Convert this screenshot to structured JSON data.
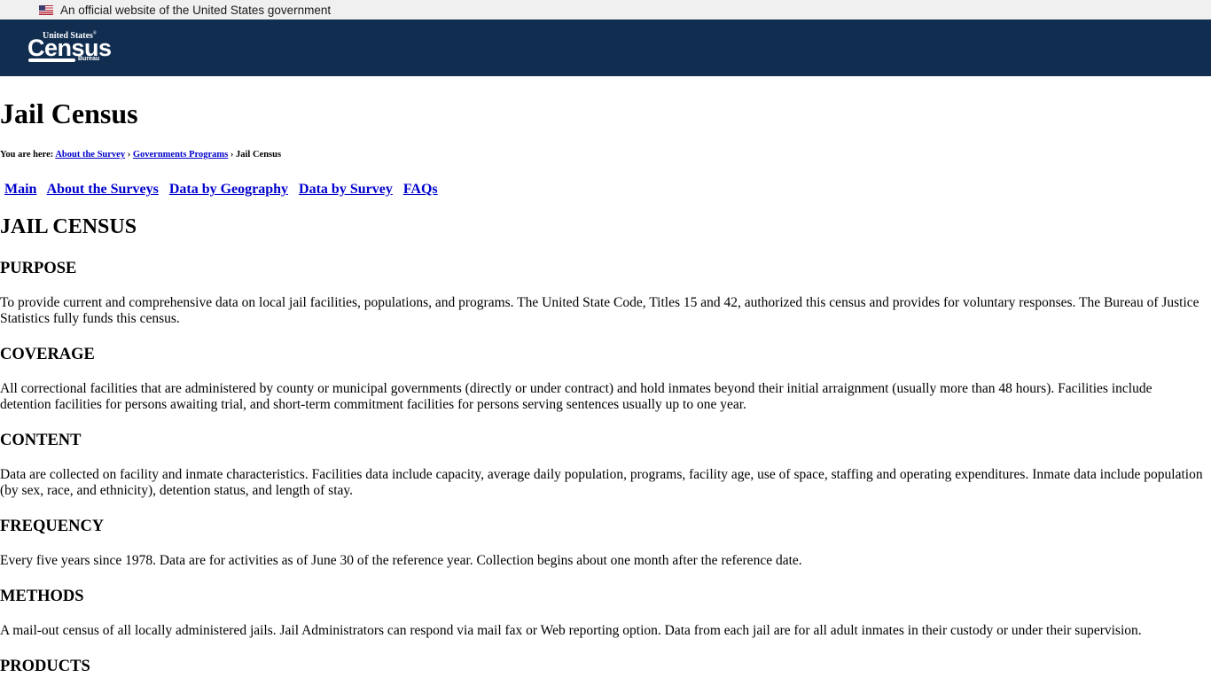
{
  "gov_banner": {
    "flag_icon": "us-flag-icon",
    "text": "An official website of the United States government"
  },
  "header": {
    "logo": {
      "line1": "United States",
      "registered": "®",
      "line2": "Census",
      "line3": "Bureau"
    }
  },
  "page_title": "Jail Census",
  "breadcrumb": {
    "prefix": "You are here:",
    "items": [
      {
        "label": "About the Survey",
        "link": true
      },
      {
        "label": "Governments Programs",
        "link": true
      },
      {
        "label": "Jail Census",
        "link": false
      }
    ],
    "separator": "›"
  },
  "nav": {
    "items": [
      {
        "label": "Main"
      },
      {
        "label": "About the Surveys"
      },
      {
        "label": "Data by Geography"
      },
      {
        "label": "Data by Survey"
      },
      {
        "label": "FAQs"
      }
    ]
  },
  "main_heading": "JAIL CENSUS",
  "sections": [
    {
      "heading": "PURPOSE",
      "text": "To provide current and comprehensive data on local jail facilities, populations, and programs. The United State Code, Titles 15 and 42, authorized this census and provides for voluntary responses. The Bureau of Justice Statistics fully funds this census."
    },
    {
      "heading": "COVERAGE",
      "text": "All correctional facilities that are administered by county or municipal governments (directly or under contract) and hold inmates beyond their initial arraignment (usually more than 48 hours). Facilities include detention facilities for persons awaiting trial, and short-term commitment facilities for persons serving sentences usually up to one year."
    },
    {
      "heading": "CONTENT",
      "text": "Data are collected on facility and inmate characteristics. Facilities data include capacity, average daily population, programs, facility age, use of space, staffing and operating expenditures. Inmate data include population (by sex, race, and ethnicity), detention status, and length of stay."
    },
    {
      "heading": "FREQUENCY",
      "text": "Every five years since 1978. Data are for activities as of June 30 of the reference year. Collection begins about one month after the reference date."
    },
    {
      "heading": "METHODS",
      "text": "A mail-out census of all locally administered jails. Jail Administrators can respond via mail fax or Web reporting option. Data from each jail are for all adult inmates in their custody or under their supervision."
    },
    {
      "heading": "PRODUCTS",
      "text": ""
    }
  ]
}
